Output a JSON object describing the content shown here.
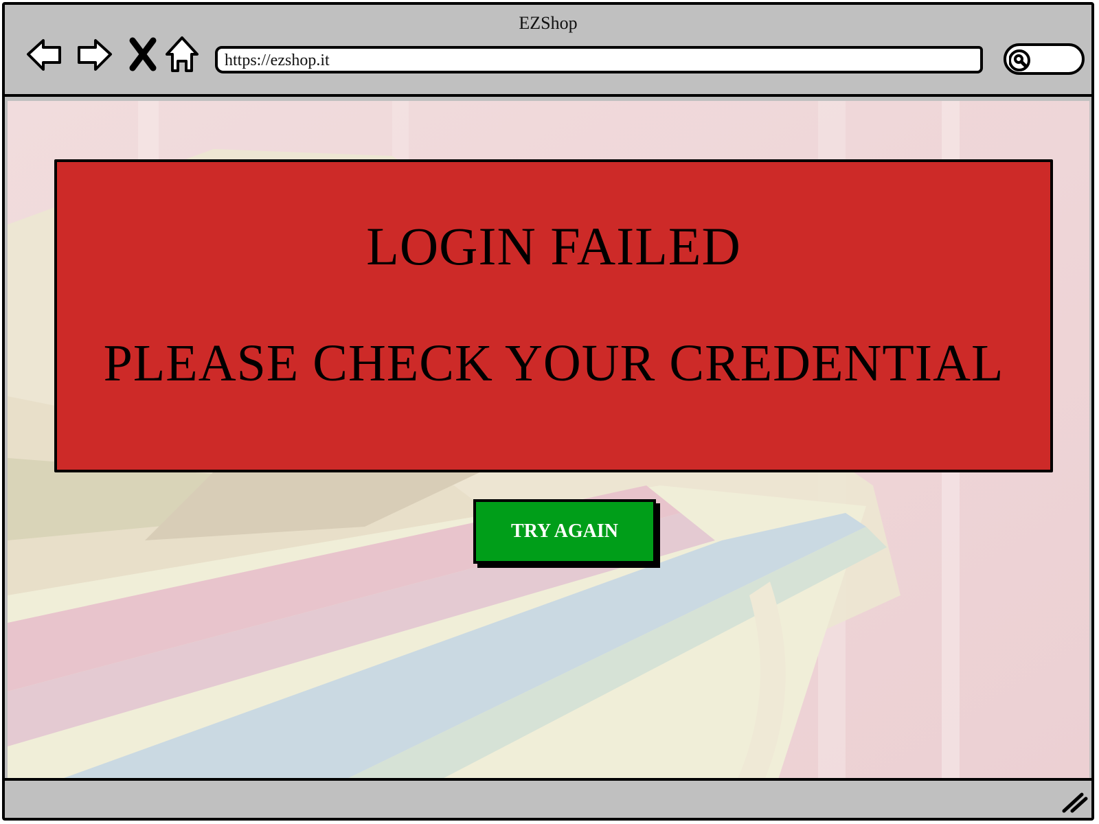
{
  "window": {
    "title": "EZShop"
  },
  "toolbar": {
    "back_icon": "arrow-left-icon",
    "forward_icon": "arrow-right-icon",
    "stop_icon": "close-icon",
    "home_icon": "home-icon",
    "url": "https://ezshop.it",
    "search_icon": "search-icon"
  },
  "main": {
    "error_title": "LOGIN FAILED",
    "error_message": "PLEASE CHECK YOUR CREDENTIAL",
    "try_again_label": "TRY AGAIN"
  },
  "colors": {
    "error_background": "#cd2a28",
    "button_background": "#009e19",
    "chrome_gray": "#c0c0c0"
  }
}
